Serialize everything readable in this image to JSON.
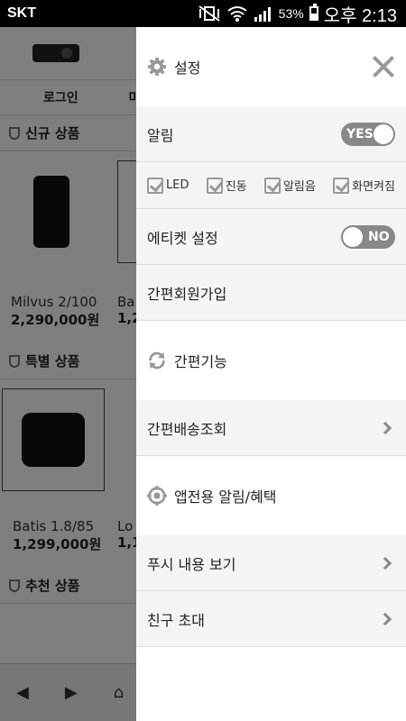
{
  "status_bar": {
    "carrier": "SKT",
    "battery": "53%",
    "battery_level": 0.53,
    "time": "오후 2:13"
  },
  "background_page": {
    "tabs": [
      "로그인",
      "마"
    ],
    "new_products": {
      "title": "신규 상품",
      "items": [
        {
          "name": "Milvus 2/100",
          "price": "2,290,000원"
        },
        {
          "name": "Ba",
          "price": "1,2"
        }
      ]
    },
    "special_products": {
      "title": "특별 상품",
      "items": [
        {
          "name": "Batis 1.8/85",
          "price": "1,299,000원"
        },
        {
          "name": "Lo",
          "price": "1,1"
        }
      ]
    },
    "recommended_products": {
      "title": "추천 상품"
    }
  },
  "drawer": {
    "settings_title": "설정",
    "notification": {
      "label": "알림",
      "toggle": "YES"
    },
    "options": [
      "LED",
      "진동",
      "알림음",
      "화면켜짐"
    ],
    "etiquette": {
      "label": "에티켓 설정",
      "toggle": "NO"
    },
    "easy_signup": "간편회원가입",
    "easy_features": "간편기능",
    "easy_delivery": "간편배송조회",
    "app_alerts": "앱전용 알림/혜택",
    "push_view": "푸시 내용 보기",
    "invite_friend": "친구 초대"
  }
}
